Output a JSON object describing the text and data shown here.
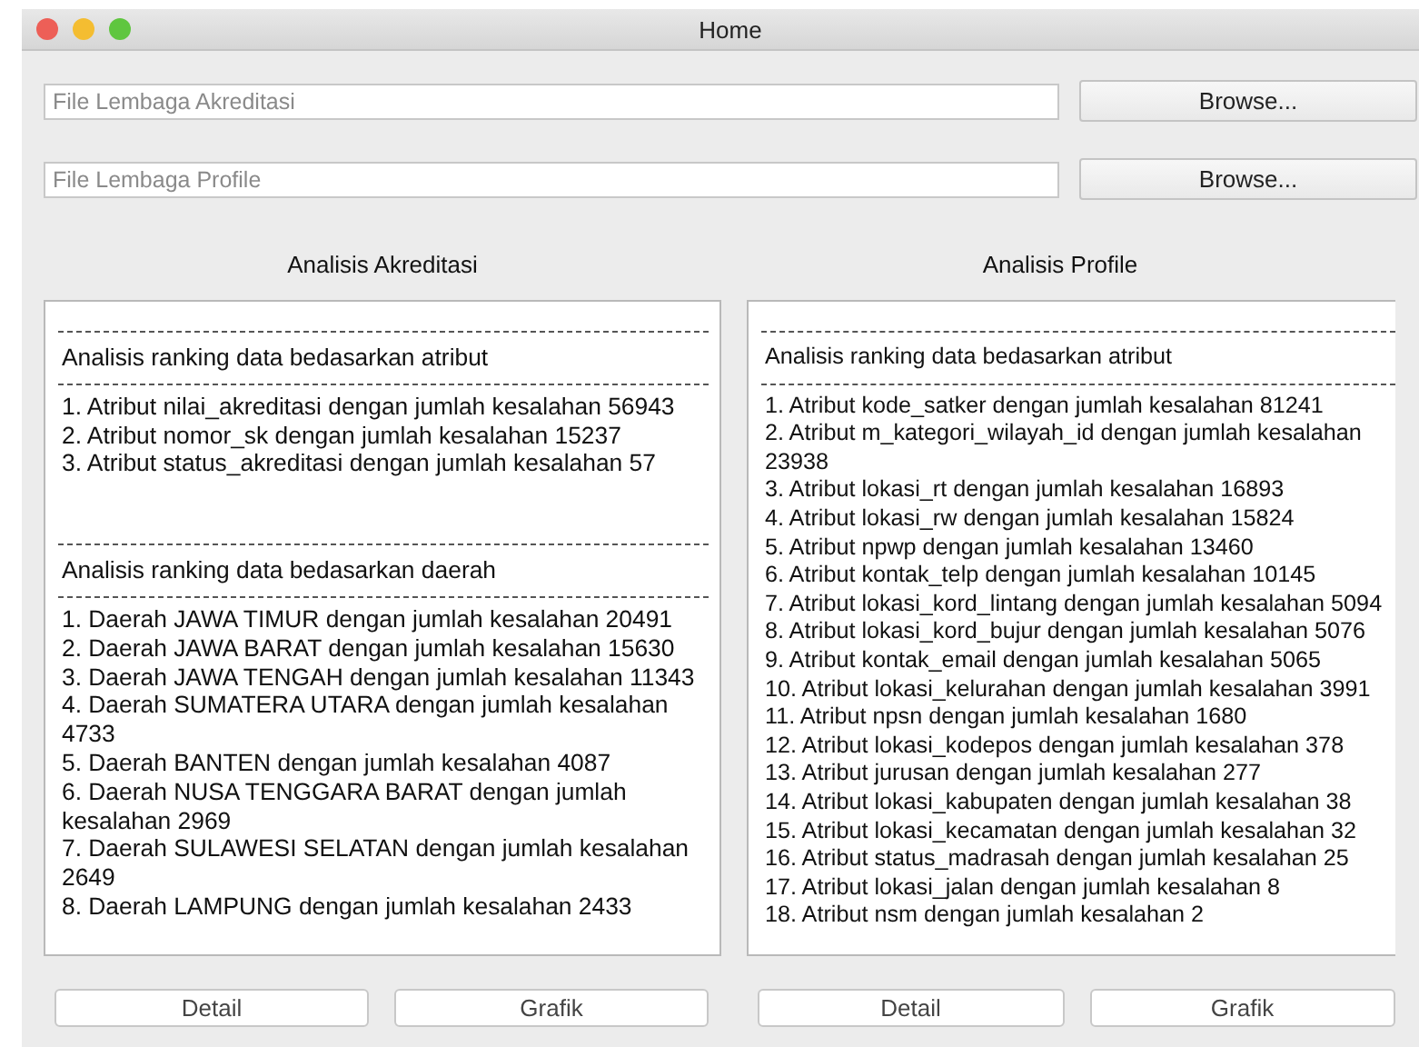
{
  "window": {
    "title": "Home"
  },
  "file_fields": [
    {
      "placeholder": "File Lembaga Akreditasi",
      "button": "Browse..."
    },
    {
      "placeholder": "File Lembaga Profile",
      "button": "Browse..."
    }
  ],
  "panels": [
    {
      "title": "Analisis Akreditasi",
      "sections": [
        {
          "heading": "Analisis ranking data bedasarkan atribut",
          "items": [
            "1. Atribut nilai_akreditasi dengan jumlah kesalahan 56943",
            "2. Atribut nomor_sk dengan jumlah kesalahan 15237",
            "3. Atribut status_akreditasi dengan jumlah kesalahan 57"
          ]
        },
        {
          "heading": "Analisis ranking data bedasarkan daerah",
          "items": [
            "1. Daerah JAWA TIMUR dengan jumlah kesalahan 20491",
            "2. Daerah JAWA BARAT dengan jumlah kesalahan 15630",
            "3. Daerah JAWA TENGAH dengan jumlah kesalahan 11343",
            "4. Daerah SUMATERA UTARA dengan jumlah kesalahan 4733",
            "5. Daerah BANTEN dengan jumlah kesalahan 4087",
            "6. Daerah NUSA TENGGARA BARAT dengan jumlah kesalahan 2969",
            "7. Daerah SULAWESI SELATAN dengan jumlah kesalahan 2649",
            "8. Daerah LAMPUNG dengan jumlah kesalahan 2433"
          ]
        }
      ],
      "buttons": [
        "Detail",
        "Grafik"
      ]
    },
    {
      "title": "Analisis Profile",
      "sections": [
        {
          "heading": "Analisis ranking data bedasarkan atribut",
          "items": [
            "1. Atribut kode_satker dengan jumlah kesalahan 81241",
            "2. Atribut m_kategori_wilayah_id dengan jumlah kesalahan 23938",
            "3. Atribut lokasi_rt dengan jumlah kesalahan 16893",
            "4. Atribut lokasi_rw dengan jumlah kesalahan 15824",
            "5. Atribut npwp dengan jumlah kesalahan 13460",
            "6. Atribut kontak_telp dengan jumlah kesalahan 10145",
            "7. Atribut lokasi_kord_lintang dengan jumlah kesalahan 5094",
            "8. Atribut lokasi_kord_bujur dengan jumlah kesalahan 5076",
            "9. Atribut kontak_email dengan jumlah kesalahan 5065",
            "10. Atribut lokasi_kelurahan dengan jumlah kesalahan 3991",
            "11. Atribut npsn dengan jumlah kesalahan 1680",
            "12. Atribut lokasi_kodepos dengan jumlah kesalahan 378",
            "13. Atribut jurusan dengan jumlah kesalahan 277",
            "14. Atribut lokasi_kabupaten dengan jumlah kesalahan 38",
            "15. Atribut lokasi_kecamatan dengan jumlah kesalahan 32",
            "16. Atribut status_madrasah dengan jumlah kesalahan 25",
            "17. Atribut lokasi_jalan dengan jumlah kesalahan 8",
            "18. Atribut nsm dengan jumlah kesalahan 2"
          ]
        }
      ],
      "buttons": [
        "Detail",
        "Grafik"
      ]
    }
  ]
}
